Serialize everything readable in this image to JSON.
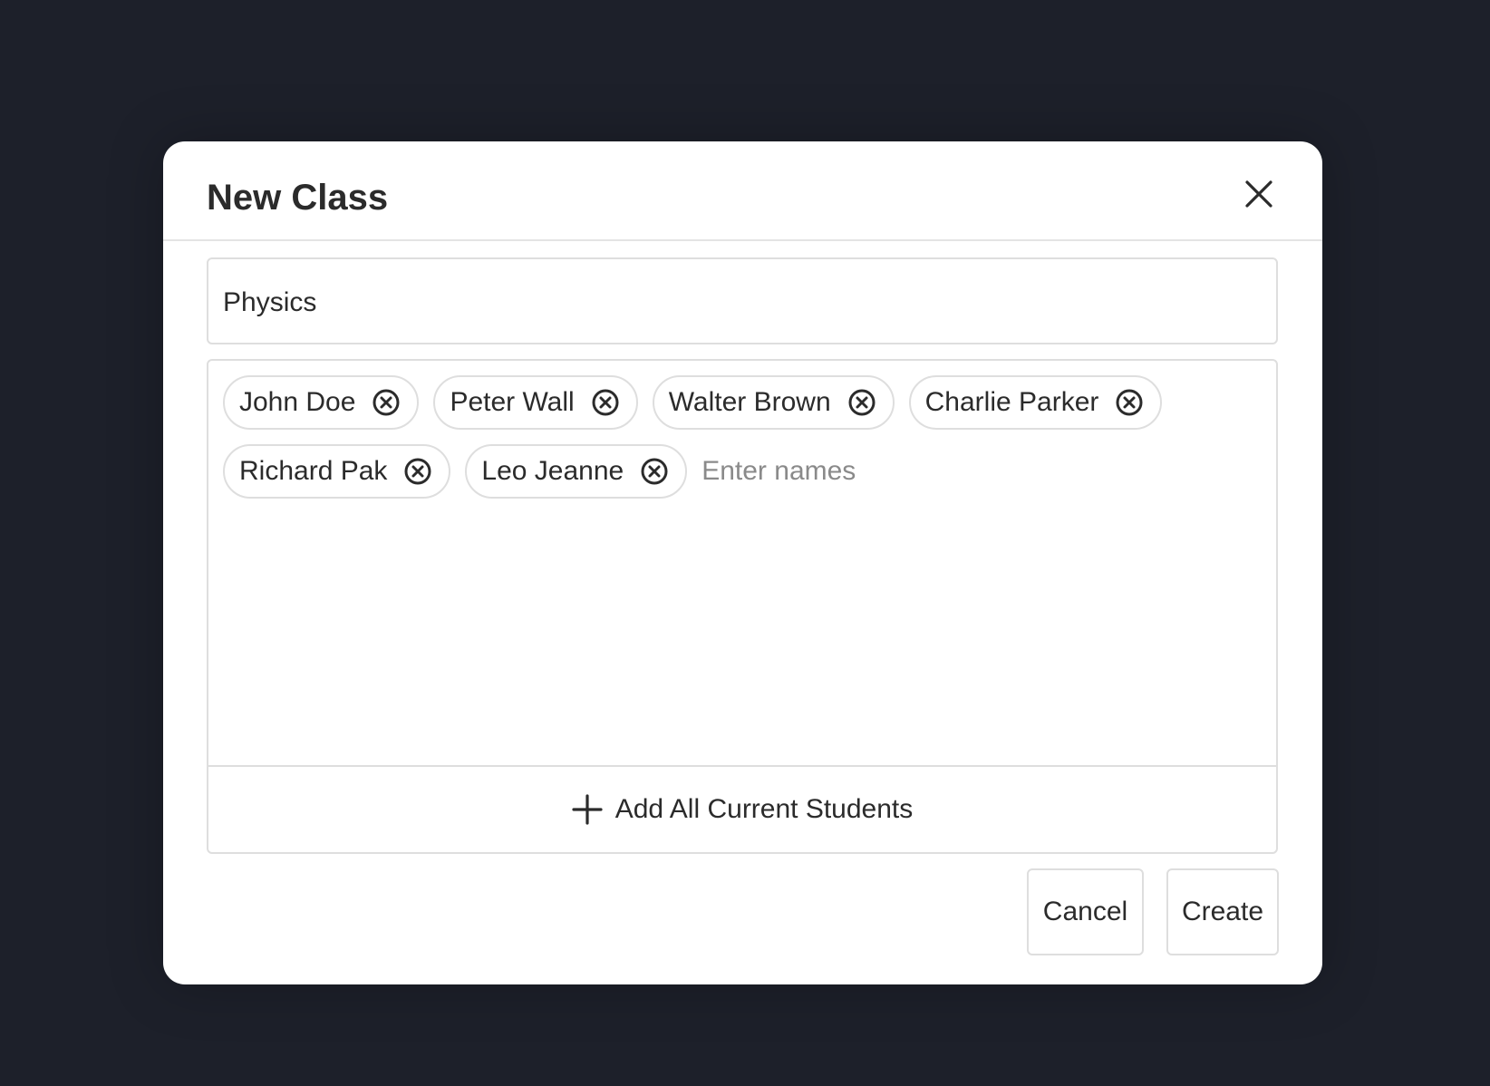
{
  "modal": {
    "title": "New Class",
    "close_icon": "close-icon"
  },
  "class_name": {
    "value": "Physics"
  },
  "students": {
    "chips": [
      {
        "label": "John Doe"
      },
      {
        "label": "Peter Wall"
      },
      {
        "label": "Walter Brown"
      },
      {
        "label": "Charlie Parker"
      },
      {
        "label": "Richard Pak"
      },
      {
        "label": "Leo Jeanne"
      }
    ],
    "remove_icon": "remove-circle-icon",
    "input_placeholder": "Enter names",
    "add_all_label": "Add All Current Students",
    "add_all_icon": "plus-icon"
  },
  "footer": {
    "cancel_label": "Cancel",
    "create_label": "Create"
  },
  "colors": {
    "backdrop": "#1d202a",
    "surface": "#ffffff",
    "border": "#dedede",
    "text": "#2b2b2b",
    "placeholder": "#8a8a8a"
  }
}
